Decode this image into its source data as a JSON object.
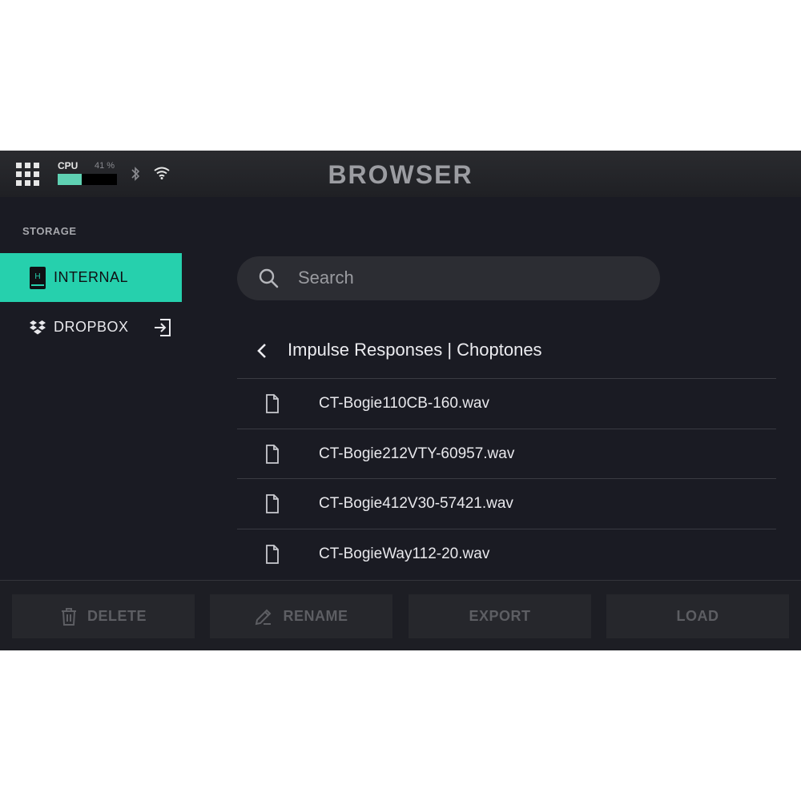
{
  "header": {
    "title": "BROWSER",
    "cpu_label": "CPU",
    "cpu_percent_text": "41 %",
    "cpu_percent": 41
  },
  "sidebar": {
    "section_label": "STORAGE",
    "items": [
      {
        "label": "INTERNAL",
        "icon": "hdd-icon",
        "selected": true
      },
      {
        "label": "DROPBOX",
        "icon": "dropbox-icon",
        "selected": false
      }
    ]
  },
  "search": {
    "placeholder": "Search"
  },
  "breadcrumb": {
    "path": "Impulse Responses | Choptones"
  },
  "files": [
    {
      "name": "CT-Bogie110CB-160.wav"
    },
    {
      "name": "CT-Bogie212VTY-60957.wav"
    },
    {
      "name": "CT-Bogie412V30-57421.wav"
    },
    {
      "name": "CT-BogieWay112-20.wav"
    }
  ],
  "actions": {
    "delete": "DELETE",
    "rename": "RENAME",
    "export": "EXPORT",
    "load": "LOAD"
  },
  "colors": {
    "accent": "#26d0ad",
    "background": "#1a1b23",
    "cpu_fill": "#5fd1b3",
    "disabled_text": "#5d5e63"
  }
}
